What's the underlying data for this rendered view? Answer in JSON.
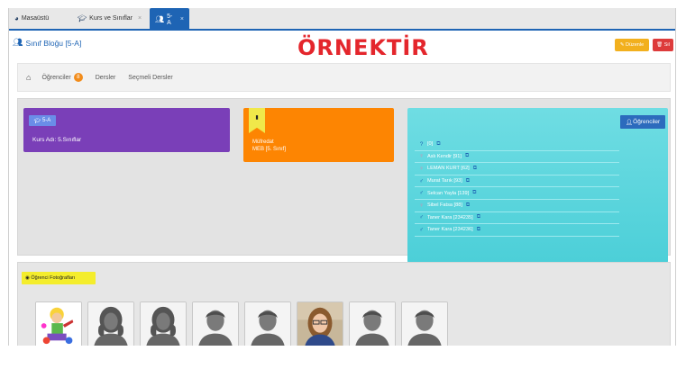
{
  "tabs": [
    {
      "label": "Masaüstü",
      "icon": "dashboard-icon"
    },
    {
      "label": "Kurs ve Sınıflar",
      "icon": "graduation-cap-icon",
      "close": "×"
    },
    {
      "label": "5-A",
      "icon": "users-icon",
      "close": "×"
    }
  ],
  "page": {
    "title": "Sınıf Bloğu [5-A]",
    "watermark": "ÖRNEKTİR",
    "edit_label": "Düzenle",
    "delete_label": "Sil"
  },
  "breadcrumb": {
    "items": [
      {
        "label": "Öğrenciler",
        "badge": "8"
      },
      {
        "label": "Dersler"
      },
      {
        "label": "Seçmeli Dersler"
      }
    ]
  },
  "class_card": {
    "tag": "5-A",
    "text": "Kurs Adı: 5.Sınıflar"
  },
  "curriculum_card": {
    "line1": "Müfredat",
    "line2": "MEB [5. Sınıf]"
  },
  "students_card": {
    "button_label": "Öğrenciler",
    "students": [
      {
        "name": "[0]",
        "gender": "unknown"
      },
      {
        "name": "Aslı Kendir [91]",
        "gender": "female"
      },
      {
        "name": "LEMAN KURT [62]",
        "gender": "female"
      },
      {
        "name": "Murat Tarık [93]",
        "gender": "male"
      },
      {
        "name": "Selcan Yayla [139]",
        "gender": "male"
      },
      {
        "name": "Sibel Fatsa [88]",
        "gender": "female"
      },
      {
        "name": "Taner Kara [234235]",
        "gender": "male"
      },
      {
        "name": "Taner Kara [234236]",
        "gender": "male"
      }
    ]
  },
  "photos": {
    "label": "Öğrenci Fotoğrafları",
    "thumbs": [
      {
        "kind": "cartoon"
      },
      {
        "kind": "female-silhouette"
      },
      {
        "kind": "female-silhouette"
      },
      {
        "kind": "male-silhouette"
      },
      {
        "kind": "male-silhouette"
      },
      {
        "kind": "photo"
      },
      {
        "kind": "male-silhouette"
      },
      {
        "kind": "male-silhouette"
      }
    ]
  },
  "colors": {
    "primary": "#1e64b4",
    "purple": "#7a3fb8",
    "orange": "#fd8502",
    "teal": "#4ccfd8",
    "watermark": "#e4262c"
  }
}
